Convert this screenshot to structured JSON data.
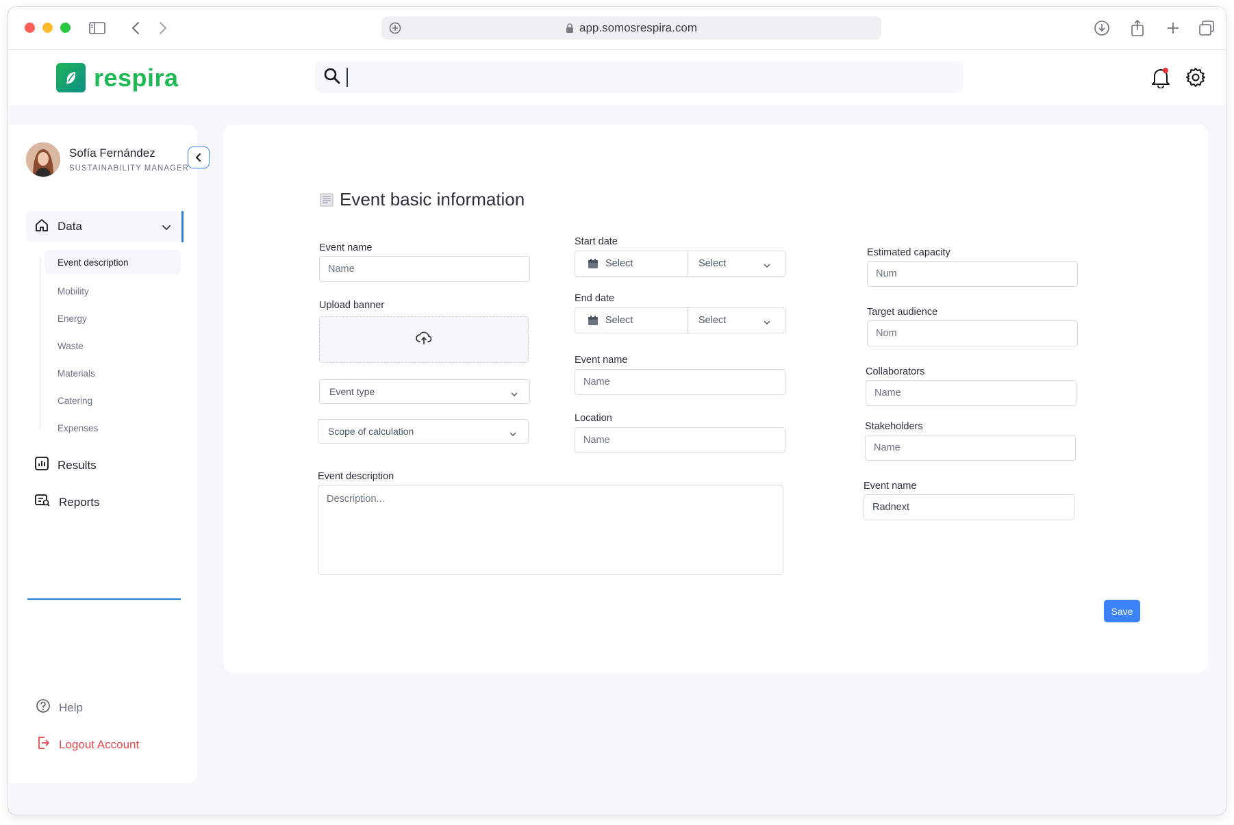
{
  "browser": {
    "url": "app.somosrespira.com"
  },
  "app": {
    "brand": "respira",
    "brand_color": "#1db954",
    "accent_color": "#3b82f6",
    "search": {
      "value": "",
      "placeholder": ""
    }
  },
  "profile": {
    "name": "Sofía Fernández",
    "role": "SUSTAINABILITY MANAGER"
  },
  "sidebar": {
    "data_label": "Data",
    "sub_items": [
      {
        "label": "Event description",
        "active": true
      },
      {
        "label": "Mobility",
        "active": false
      },
      {
        "label": "Energy",
        "active": false
      },
      {
        "label": "Waste",
        "active": false
      },
      {
        "label": "Materials",
        "active": false
      },
      {
        "label": "Catering",
        "active": false
      },
      {
        "label": "Expenses",
        "active": false
      }
    ],
    "results_label": "Results",
    "reports_label": "Reports",
    "help_label": "Help",
    "logout_label": "Logout Account",
    "logout_color": "#e5484d"
  },
  "form": {
    "title": "Event basic information",
    "event_name": {
      "label": "Event name",
      "placeholder": "Name"
    },
    "upload_banner": {
      "label": "Upload banner"
    },
    "event_type": {
      "placeholder": "Event type"
    },
    "scope": {
      "placeholder": "Scope of calculation"
    },
    "event_description": {
      "label": "Event description",
      "placeholder": "Description..."
    },
    "start_date": {
      "label": "Start date",
      "date_placeholder": "Select",
      "time_placeholder": "Select"
    },
    "end_date": {
      "label": "End date",
      "date_placeholder": "Select",
      "time_placeholder": "Select"
    },
    "event_name_2": {
      "label": "Event name",
      "placeholder": "Name"
    },
    "location": {
      "label": "Location",
      "placeholder": "Name"
    },
    "estimated_capacity": {
      "label": "Estimated capacity",
      "placeholder": "Num"
    },
    "target_audience": {
      "label": "Target audience",
      "placeholder": "Nom"
    },
    "collaborators": {
      "label": "Collaborators",
      "placeholder": "Name"
    },
    "stakeholders": {
      "label": "Stakeholders",
      "placeholder": "Name"
    },
    "event_name_3": {
      "label": "Event name",
      "value": "Radnext"
    },
    "save_label": "Save"
  }
}
